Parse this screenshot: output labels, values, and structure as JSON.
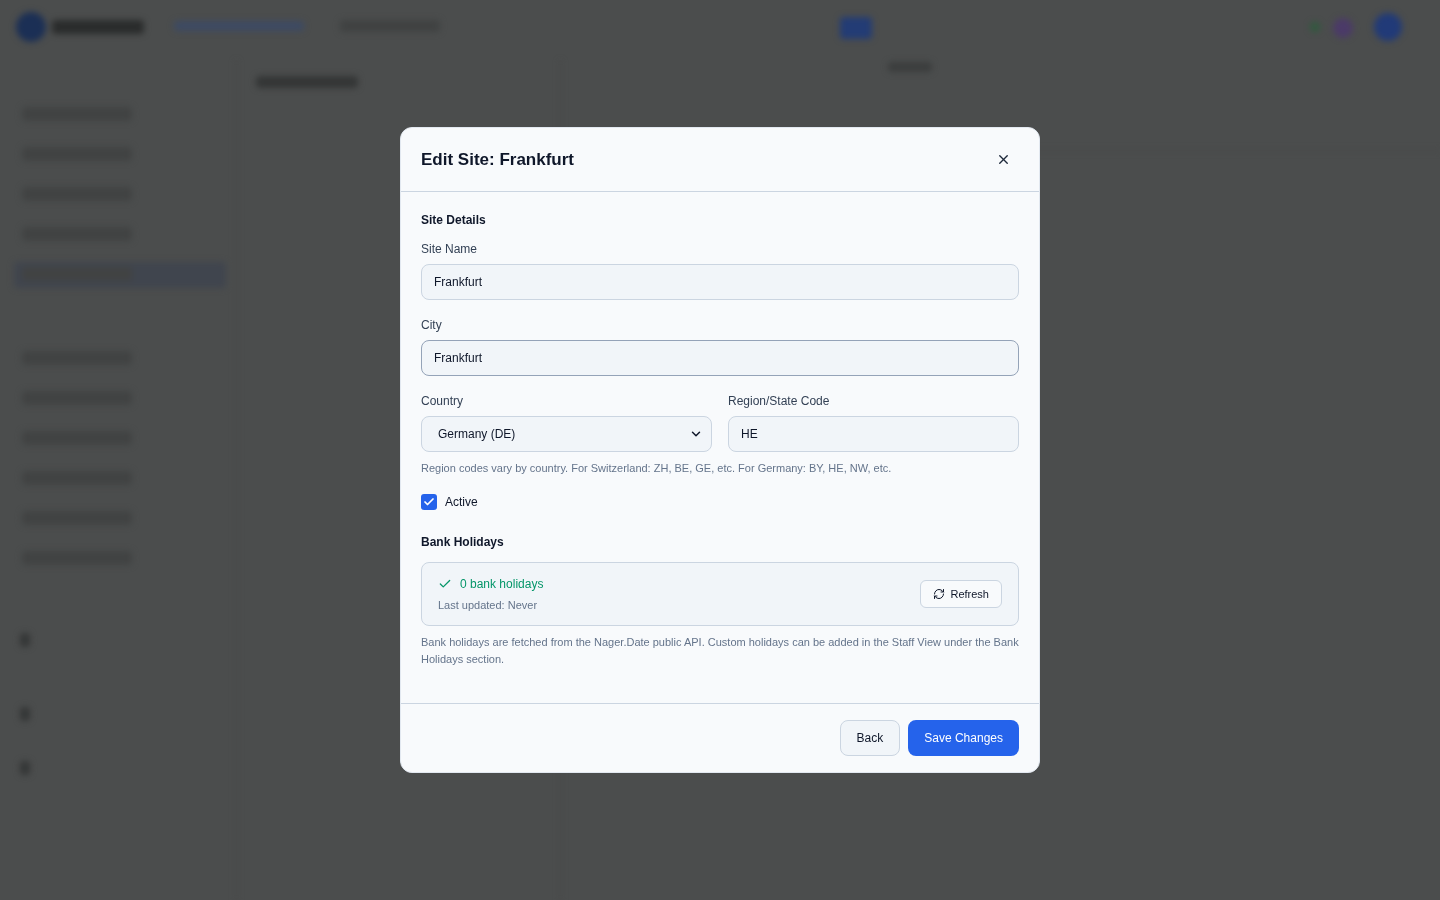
{
  "dialog": {
    "title": "Edit Site: Frankfurt"
  },
  "site_details": {
    "heading": "Site Details",
    "rows": [
      [
        {
          "kind": "text",
          "label": "Site Name",
          "value": "Frankfurt",
          "focused": false
        }
      ],
      [
        {
          "kind": "text",
          "label": "City",
          "value": "Frankfurt",
          "focused": true
        }
      ],
      [
        {
          "kind": "select",
          "label": "Country",
          "value": "Germany (DE)",
          "focused": false
        },
        {
          "kind": "text",
          "label": "Region/State Code",
          "value": "HE",
          "focused": false
        }
      ]
    ],
    "hint": "Region codes vary by country. For Switzerland: ZH, BE, GE, etc. For Germany: BY, HE, NW, etc.",
    "active": {
      "label": "Active",
      "checked": true
    }
  },
  "bank_holidays": {
    "heading": "Bank Holidays",
    "status": {
      "synced": true,
      "count": "0 bank holidays",
      "last_updated": "Last updated: Never",
      "refresh_button": "Refresh"
    },
    "note": "Bank holidays are fetched from the Nager.Date public API. Custom holidays can be added in the Staff View under the Bank Holidays section."
  },
  "footer": {
    "buttons": [
      {
        "kind": "secondary",
        "label": "Back"
      },
      {
        "kind": "primary",
        "label": "Save Changes"
      }
    ]
  }
}
